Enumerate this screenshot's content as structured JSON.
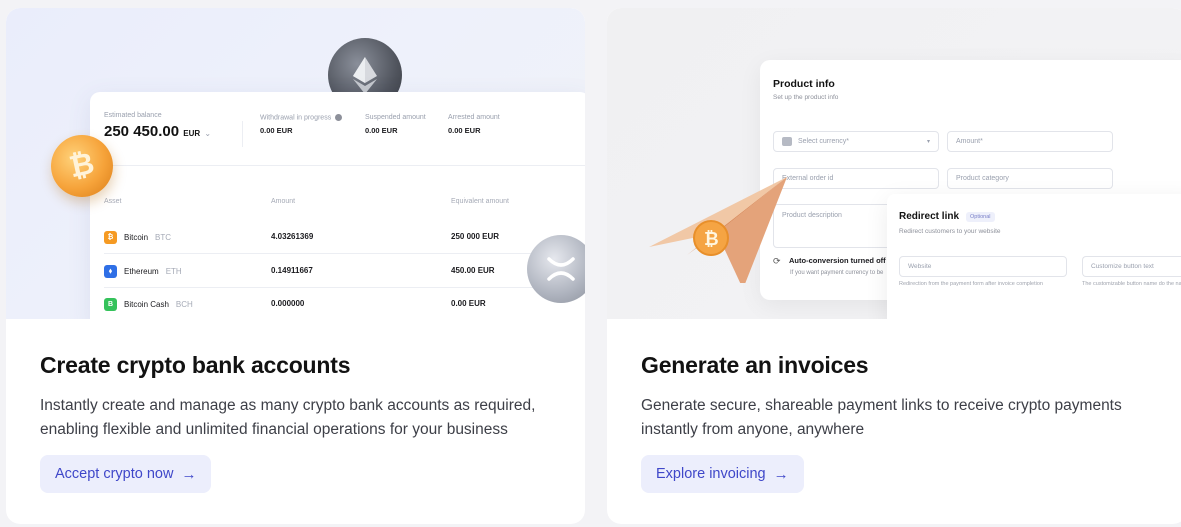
{
  "cards": [
    {
      "title": "Create crypto bank accounts",
      "description": "Instantly create and manage as many crypto bank accounts as required, enabling flexible and unlimited financial operations for your business",
      "cta": "Accept crypto now",
      "cta_arrow": "→"
    },
    {
      "title": "Generate an invoices",
      "description": "Generate secure, shareable payment links to receive crypto payments instantly from anyone, anywhere",
      "cta": "Explore invoicing",
      "cta_arrow": "→"
    }
  ],
  "balance_panel": {
    "estimated_label": "Estimated balance",
    "estimated_value": "250 450.00",
    "estimated_currency": "EUR",
    "estimated_chevron": "⌄",
    "withdrawal_label": "Withdrawal in progress",
    "withdrawal_value": "0.00 EUR",
    "suspended_label": "Suspended amount",
    "suspended_value": "0.00 EUR",
    "arrested_label": "Arrested amount",
    "arrested_value": "0.00 EUR",
    "col_asset": "Asset",
    "col_amount": "Amount",
    "col_equivalent": "Equivalent amount",
    "rows": [
      {
        "name": "Bitcoin",
        "ticker": "BTC",
        "amount": "4.03261369",
        "equivalent": "250 000 EUR",
        "icon": "bitcoin-icon",
        "color": "#f59a23",
        "glyph": "₿"
      },
      {
        "name": "Ethereum",
        "ticker": "ETH",
        "amount": "0.14911667",
        "equivalent": "450.00 EUR",
        "icon": "ethereum-icon",
        "color": "#2f6fe6",
        "glyph": "⬧"
      },
      {
        "name": "Bitcoin Cash",
        "ticker": "BCH",
        "amount": "0.000000",
        "equivalent": "0.00 EUR",
        "icon": "bitcoin-cash-icon",
        "color": "#35c25b",
        "glyph": "B"
      }
    ]
  },
  "invoice_form": {
    "title": "Product info",
    "subtitle": "Set up the product info",
    "select_currency": "Select currency*",
    "amount": "Amount*",
    "external_order": "External order id",
    "product_category": "Product category",
    "product_description": "Product description",
    "auto_conversion": "Auto-conversion turned off",
    "auto_conversion_sub": "If you want payment currency to be"
  },
  "redirect_panel": {
    "title": "Redirect link",
    "optional": "Optional",
    "subtitle": "Redirect customers to your website",
    "website": "Website",
    "customize": "Customize button text",
    "website_hint": "Redirection from the payment form after invoice completion",
    "customize_hint": "The customizable button name do the name is user-friendly and acce"
  },
  "colors": {
    "cta_bg": "#eceefc",
    "cta_text": "#3f47c9",
    "bitcoin": "#f59a23"
  }
}
